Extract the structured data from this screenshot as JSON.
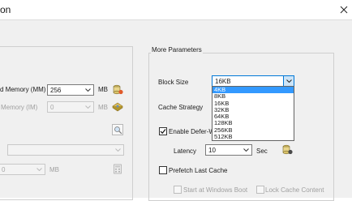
{
  "window": {
    "title": "on",
    "close_glyph": "✕"
  },
  "left": {
    "memory_label": "d Memory (MM)",
    "memory_value": "256",
    "memory_unit": "MB",
    "indirect_label": "Memory (IM)",
    "indirect_value": "0",
    "indirect_unit": "MB",
    "lower_value": "0",
    "lower_unit": "MB"
  },
  "more": {
    "group_title": "More Parameters",
    "block_size_label": "Block Size",
    "block_size_value": "16KB",
    "block_size_options": [
      "4KB",
      "8KB",
      "16KB",
      "32KB",
      "64KB",
      "128KB",
      "256KB",
      "512KB"
    ],
    "selected_option": "4KB",
    "cache_strategy_label": "Cache Strategy",
    "defer_write_label": "Enable Defer-Wr",
    "defer_write_checked": true,
    "latency_label": "Latency",
    "latency_value": "10",
    "latency_unit": "Sec",
    "prefetch_label": "Prefetch Last Cache",
    "prefetch_checked": false,
    "start_boot_label": "Start at Windows Boot",
    "lock_cache_label": "Lock Cache Content"
  },
  "colors": {
    "accent": "#0078d7",
    "highlight": "#3399ff",
    "disabled_text": "#a0a0a0"
  }
}
